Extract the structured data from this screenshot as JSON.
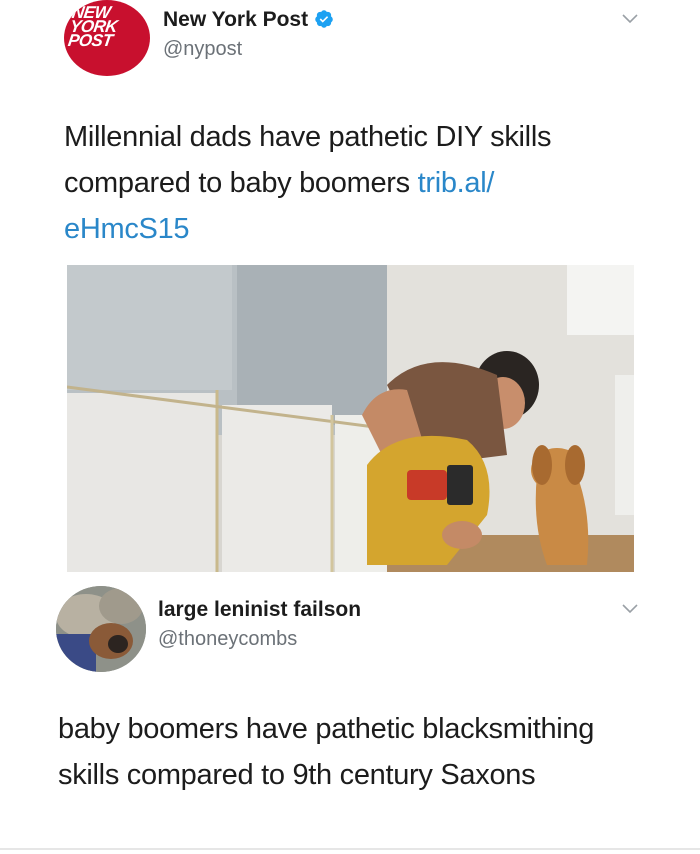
{
  "tweets": [
    {
      "author": {
        "display_name": "New York Post",
        "handle": "@nypost",
        "verified": true,
        "avatar_icon": "new-york-post-logo",
        "avatar_logo_text": "NEW YORK POST"
      },
      "text": "Millennial dads have pathetic DIY skills compared to baby boomers ",
      "link_text": "trib.al/\neHmcS15",
      "link_part_1": "trib.al/",
      "link_part_2": "eHmcS15",
      "media": {
        "type": "photo",
        "description_icon": "man-with-drill-and-dog-photo"
      },
      "menu_icon": "chevron-down-icon"
    },
    {
      "author": {
        "display_name": "large leninist failson",
        "handle": "@thoneycombs",
        "avatar_icon": "user-avatar-photo"
      },
      "text": "baby boomers have pathetic blacksmithing skills compared to 9th century Saxons",
      "menu_icon": "chevron-down-icon"
    }
  ],
  "colors": {
    "link": "#2a87c9",
    "verified_badge": "#1da1f2",
    "nyp_brand": "#c8102e",
    "handle_gray": "#6b7177"
  }
}
